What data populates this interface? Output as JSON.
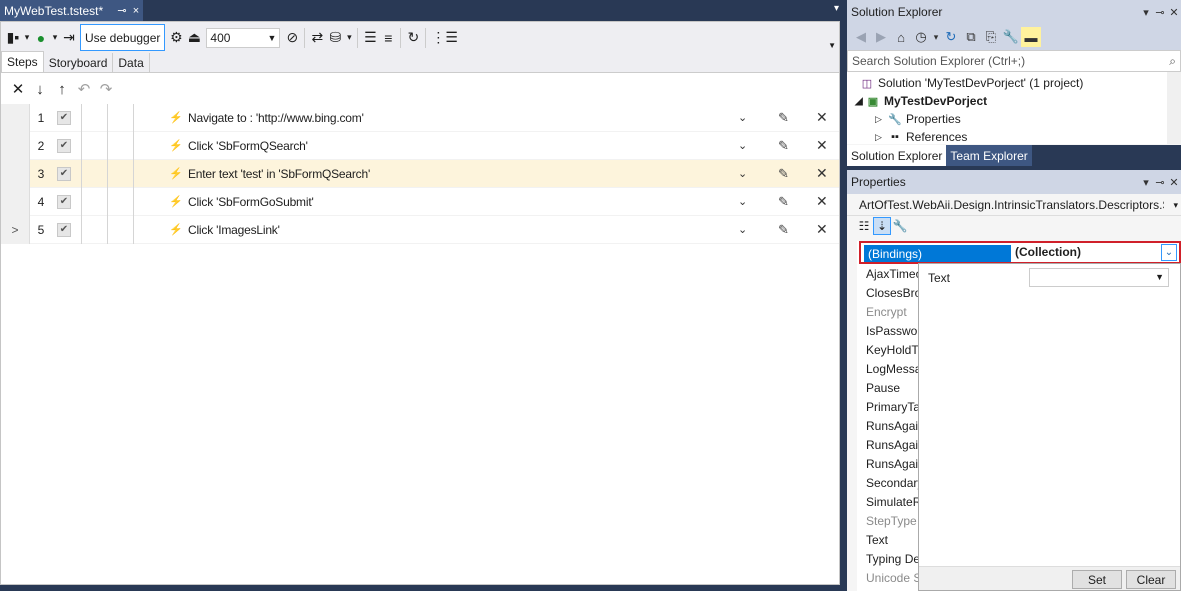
{
  "document": {
    "tab_title": "MyWebTest.tstest*",
    "tab_pin_icon": "pin-icon",
    "tab_close": "×",
    "overflow_arrow": "▾"
  },
  "toolbar": {
    "use_debugger_label": "Use debugger",
    "speed_value": "400"
  },
  "step_tabs": [
    "Steps",
    "Storyboard",
    "Data"
  ],
  "steps": [
    {
      "num": "1",
      "desc": "Navigate to : 'http://www.bing.com'",
      "selected": false,
      "has_expander": false
    },
    {
      "num": "2",
      "desc": "Click 'SbFormQSearch'",
      "selected": false,
      "has_expander": false
    },
    {
      "num": "3",
      "desc": "Enter text 'test' in 'SbFormQSearch'",
      "selected": true,
      "has_expander": false
    },
    {
      "num": "4",
      "desc": "Click 'SbFormGoSubmit'",
      "selected": false,
      "has_expander": false
    },
    {
      "num": "5",
      "desc": "Click 'ImagesLink'",
      "selected": false,
      "has_expander": true
    }
  ],
  "solution_explorer": {
    "title": "Solution Explorer",
    "search_placeholder": "Search Solution Explorer (Ctrl+;)",
    "tree": [
      {
        "label": "Solution 'MyTestDevPorject' (1 project)",
        "bold": false
      },
      {
        "label": "MyTestDevPorject",
        "bold": true
      },
      {
        "label": "Properties",
        "bold": false
      },
      {
        "label": "References",
        "bold": false
      }
    ],
    "tabs": [
      "Solution Explorer",
      "Team Explorer"
    ]
  },
  "properties": {
    "title": "Properties",
    "object": "ArtOfTest.WebAii.Design.IntrinsicTranslators.Descriptors.Se",
    "bindings_name": "(Bindings)",
    "bindings_value": "(Collection)",
    "items": [
      {
        "name": "AjaxTimeo",
        "gray": false
      },
      {
        "name": "ClosesBro",
        "gray": false
      },
      {
        "name": "Encrypt",
        "gray": true
      },
      {
        "name": "IsPasswor",
        "gray": false
      },
      {
        "name": "KeyHoldTi",
        "gray": false
      },
      {
        "name": "LogMessa",
        "gray": false
      },
      {
        "name": "Pause",
        "gray": false
      },
      {
        "name": "PrimaryTa",
        "gray": false
      },
      {
        "name": "RunsAgain",
        "gray": false
      },
      {
        "name": "RunsAgain",
        "gray": false
      },
      {
        "name": "RunsAgain",
        "gray": false
      },
      {
        "name": "Secondary",
        "gray": false
      },
      {
        "name": "SimulateR",
        "gray": false
      },
      {
        "name": "StepType",
        "gray": true
      },
      {
        "name": "Text",
        "gray": false
      },
      {
        "name": "Typing De",
        "gray": false
      },
      {
        "name": "Unicode S",
        "gray": true
      }
    ],
    "popup": {
      "label": "Text",
      "set_label": "Set",
      "clear_label": "Clear"
    }
  },
  "colors": {
    "frame": "#293955",
    "accent": "#0078d7",
    "selected_row": "#fdf4dc",
    "highlight_border": "#d0202a"
  }
}
